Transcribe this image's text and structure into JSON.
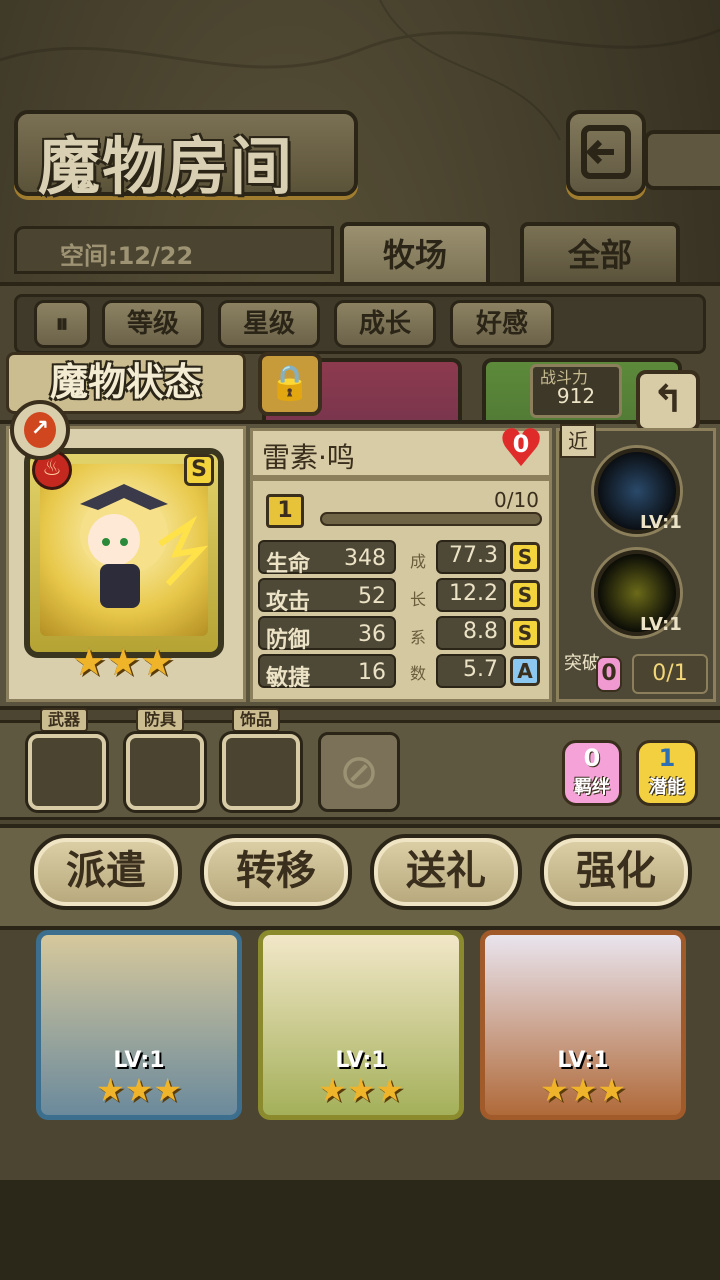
{
  "header": {
    "title": "魔物房间",
    "space_label": "空间:12/22"
  },
  "tabs": [
    {
      "label": "牧场"
    },
    {
      "label": "全部"
    }
  ],
  "filters": [
    "等级",
    "星级",
    "成长",
    "好感"
  ],
  "status": {
    "title": "魔物状态",
    "name": "雷素·鸣",
    "affection": "0",
    "level": "1",
    "exp": "0/10",
    "power_label": "战斗力",
    "power": "912",
    "range": "近",
    "rank": "S",
    "stars": "★★★",
    "stats": [
      {
        "label": "生命",
        "value": "348",
        "growth": "77.3",
        "grade": "S"
      },
      {
        "label": "攻击",
        "value": "52",
        "growth": "12.2",
        "grade": "S"
      },
      {
        "label": "防御",
        "value": "36",
        "growth": "8.8",
        "grade": "S"
      },
      {
        "label": "敏捷",
        "value": "16",
        "growth": "5.7",
        "grade": "A"
      }
    ],
    "growth_label": [
      "成",
      "长",
      "系",
      "数"
    ],
    "skills": [
      {
        "lv": "LV:1"
      },
      {
        "lv": "LV:1"
      }
    ],
    "breakthrough": {
      "label": "突破",
      "badge": "0",
      "value": "0/1"
    }
  },
  "equipment": {
    "weapon": "武器",
    "armor": "防具",
    "accessory": "饰品"
  },
  "bond": {
    "value": "0",
    "label": "羁绊"
  },
  "potential": {
    "value": "1",
    "label": "潜能"
  },
  "actions": [
    "派遣",
    "转移",
    "送礼",
    "强化"
  ],
  "monsters": [
    {
      "lv": "LV:1",
      "stars": "★★★"
    },
    {
      "lv": "LV:1",
      "stars": "★★★"
    },
    {
      "lv": "LV:1",
      "stars": "★★★"
    }
  ]
}
